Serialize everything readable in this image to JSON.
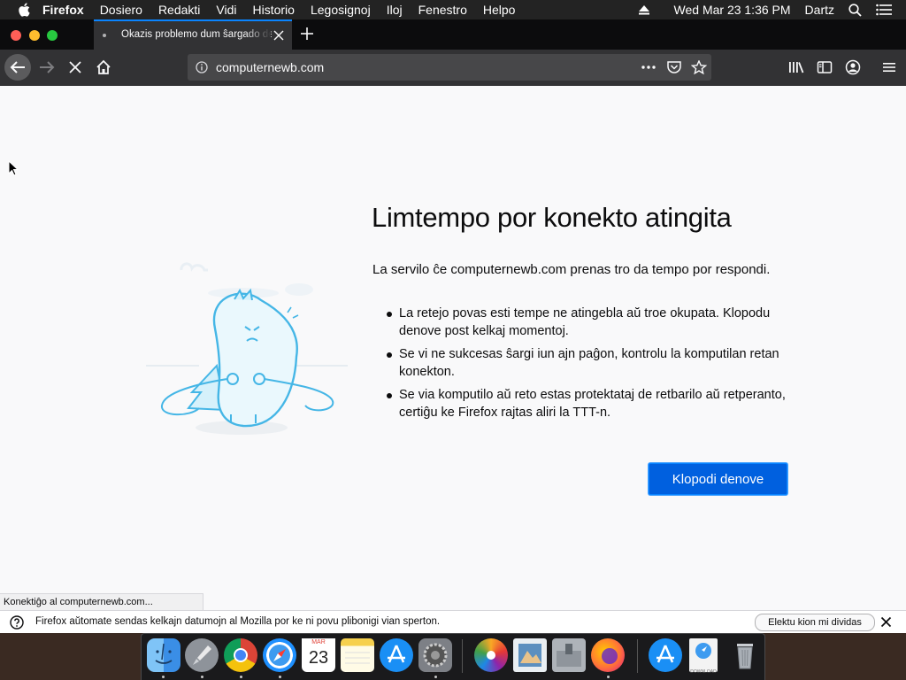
{
  "menubar": {
    "app_name": "Firefox",
    "items": [
      "Dosiero",
      "Redakti",
      "Vidi",
      "Historio",
      "Legosignoj",
      "Iloj",
      "Fenestro",
      "Helpo"
    ],
    "clock": "Wed Mar 23  1:36 PM",
    "user": "Dartz"
  },
  "tab": {
    "title": "Okazis problemo dum ŝargado de paĝo"
  },
  "urlbar": {
    "url": "computernewb.com"
  },
  "error": {
    "title": "Limtempo por konekto atingita",
    "description": "La servilo ĉe computernewb.com prenas tro da tempo por respondi.",
    "bullets": [
      "La retejo povas esti tempe ne atingebla aŭ troe okupata. Klopodu denove post kelkaj momentoj.",
      "Se vi ne sukcesas ŝargi iun ajn paĝon, kontrolu la komputilan retan konekton.",
      "Se via komputilo aŭ reto estas protektataj de retbarilo aŭ retperanto, certiĝu ke Firefox rajtas aliri la TTT-n."
    ],
    "try_again_label": "Klopodi denove"
  },
  "status": {
    "text": "Konektiĝo al computernewb.com..."
  },
  "notification": {
    "text": "Firefox aŭtomate sendas kelkajn datumojn al Mozilla por ke ni povu plibonigi vian sperton.",
    "button_label": "Elektu kion mi dividas"
  },
  "dock": {
    "calendar_month": "MAR",
    "calendar_day": "23",
    "download_label": "DOWNLOAD",
    "items": [
      "finder-icon",
      "launchpad-icon",
      "chrome-icon",
      "safari-icon",
      "calendar-icon",
      "notes-icon",
      "app-store-icon",
      "system-preferences-icon",
      "photos-icon",
      "preview-icon",
      "archive-utility-icon",
      "firefox-icon",
      "app-store-icon",
      "downloads-icon",
      "trash-icon"
    ]
  },
  "colors": {
    "accent": "#0a84ff",
    "button_primary": "#0060df",
    "menubar_bg": "#232323",
    "toolbar_bg": "#323234"
  }
}
